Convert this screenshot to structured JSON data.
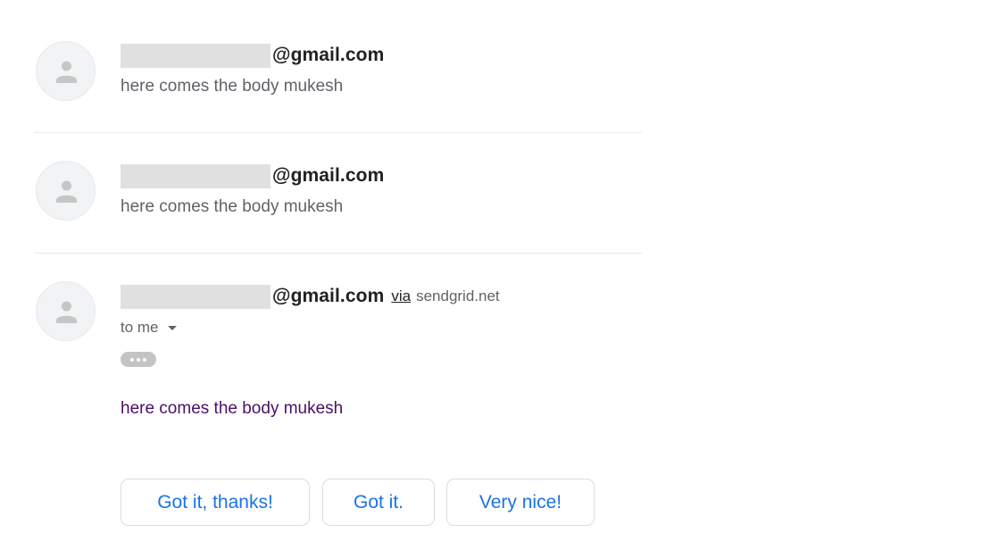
{
  "messages": [
    {
      "sender_domain": "@gmail.com",
      "snippet": "here comes the body mukesh"
    },
    {
      "sender_domain": "@gmail.com",
      "snippet": "here comes the body mukesh"
    },
    {
      "sender_domain": "@gmail.com",
      "via_label": "via",
      "via_domain": "sendgrid.net",
      "recipient_label": "to me",
      "body": "here comes the body mukesh"
    }
  ],
  "smart_replies": [
    "Got it, thanks!",
    "Got it.",
    "Very nice!"
  ],
  "icons": {
    "avatar": "person-icon",
    "recipient_caret": "caret-down-icon",
    "trimmed_content": "ellipsis-icon"
  },
  "colors": {
    "reply_accent": "#1a73e8",
    "body_text": "#4a1068",
    "muted_text": "#5f6368",
    "redaction": "#e0e0e0"
  }
}
